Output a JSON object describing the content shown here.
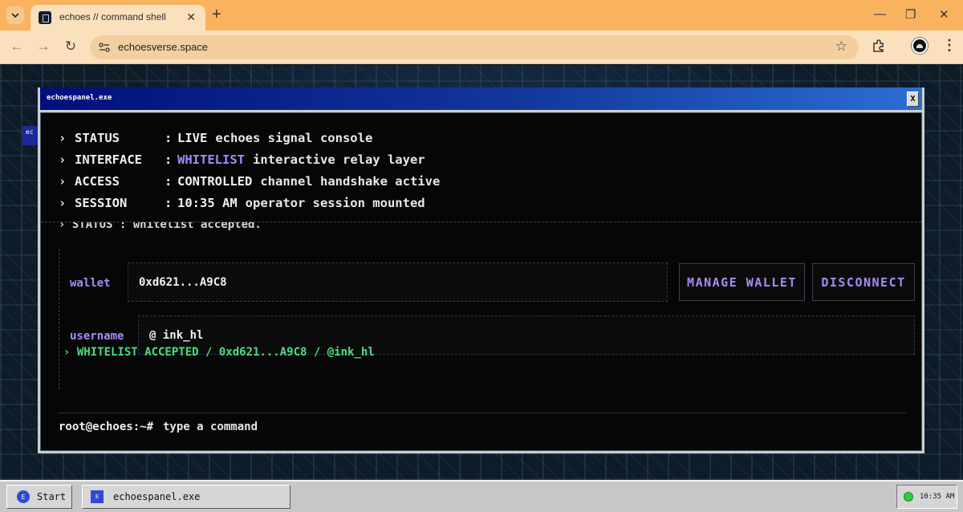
{
  "browser": {
    "tab_title": "echoes // command shell",
    "url": "echoesverse.space",
    "colors": {
      "tabbar": "#f9b35f",
      "toolbar": "#fbe0bd",
      "omnibox": "#f3cfa0"
    }
  },
  "desktop": {
    "icon_label": "ec"
  },
  "panel": {
    "title": "echoespanel.exe",
    "close_label": "X",
    "info_lines": [
      {
        "key": "STATUS",
        "highlight": "LIVE",
        "rest": "echoes signal console"
      },
      {
        "key": "INTERFACE",
        "highlight": "WHITELIST",
        "rest": "interactive relay layer"
      },
      {
        "key": "ACCESS",
        "highlight": "CONTROLLED",
        "rest": "channel handshake active"
      },
      {
        "key": "SESSION",
        "highlight": "10:35 AM",
        "rest": "operator session mounted"
      }
    ],
    "hidden_line": "› STATUS : whitelist accepted.",
    "wallet_label": "wallet",
    "wallet_value": "0xd621...A9C8",
    "manage_wallet_label": "MANAGE WALLET",
    "disconnect_label": "DISCONNECT",
    "username_label": "username",
    "username_value": "@ ink_hl",
    "accepted_line": "› WHITELIST ACCEPTED / 0xd621...A9C8 / @ink_hl",
    "prompt": "root@echoes:~#",
    "command_placeholder": "type a command",
    "colors": {
      "accent_purple": "#a78bfa",
      "accent_green": "#4ade80",
      "title_gradient_start": "#010f7a",
      "title_gradient_end": "#2b6ed4"
    }
  },
  "taskbar": {
    "start_label": "Start",
    "app_label": "echoespanel.exe",
    "clock": "10:35 AM",
    "status_color": "#2ecc40"
  }
}
